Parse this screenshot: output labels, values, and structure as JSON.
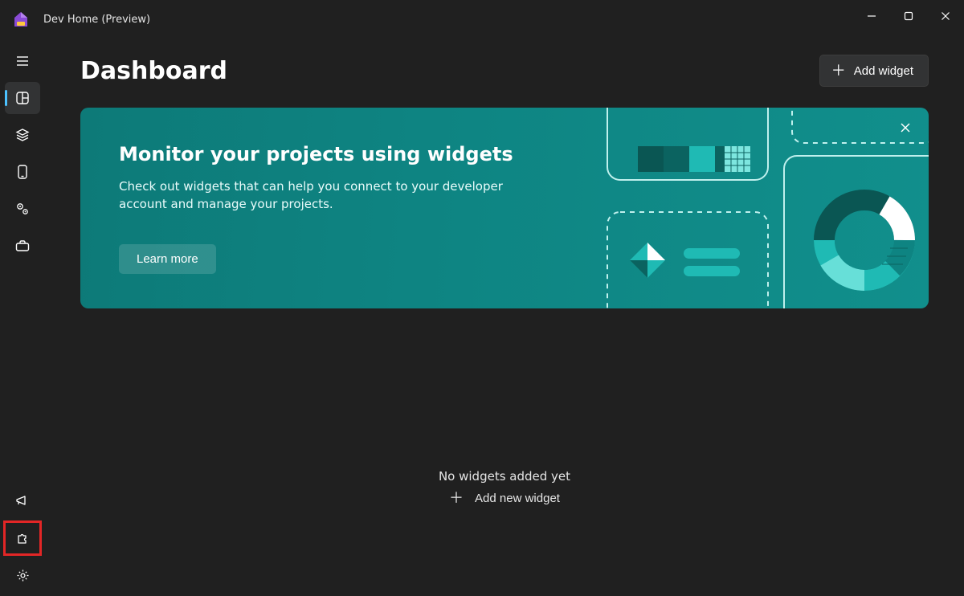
{
  "app": {
    "title": "Dev Home (Preview)"
  },
  "page": {
    "title": "Dashboard",
    "add_widget_label": "Add widget"
  },
  "banner": {
    "title": "Monitor your projects using widgets",
    "description": "Check out widgets that can help you connect to your developer account and manage your projects.",
    "learn_more_label": "Learn more"
  },
  "empty": {
    "title": "No widgets added yet",
    "add_new_label": "Add new widget"
  },
  "sidebar": {
    "items": {
      "menu": "menu",
      "dashboard": "dashboard",
      "layers": "machine-configuration",
      "device": "device",
      "gears": "environments",
      "toolbox": "utilities"
    },
    "bottom": {
      "feedback": "feedback",
      "extensions": "extensions",
      "settings": "settings"
    }
  },
  "colors": {
    "accent": "#0f7a78",
    "highlight": "#e32626"
  }
}
